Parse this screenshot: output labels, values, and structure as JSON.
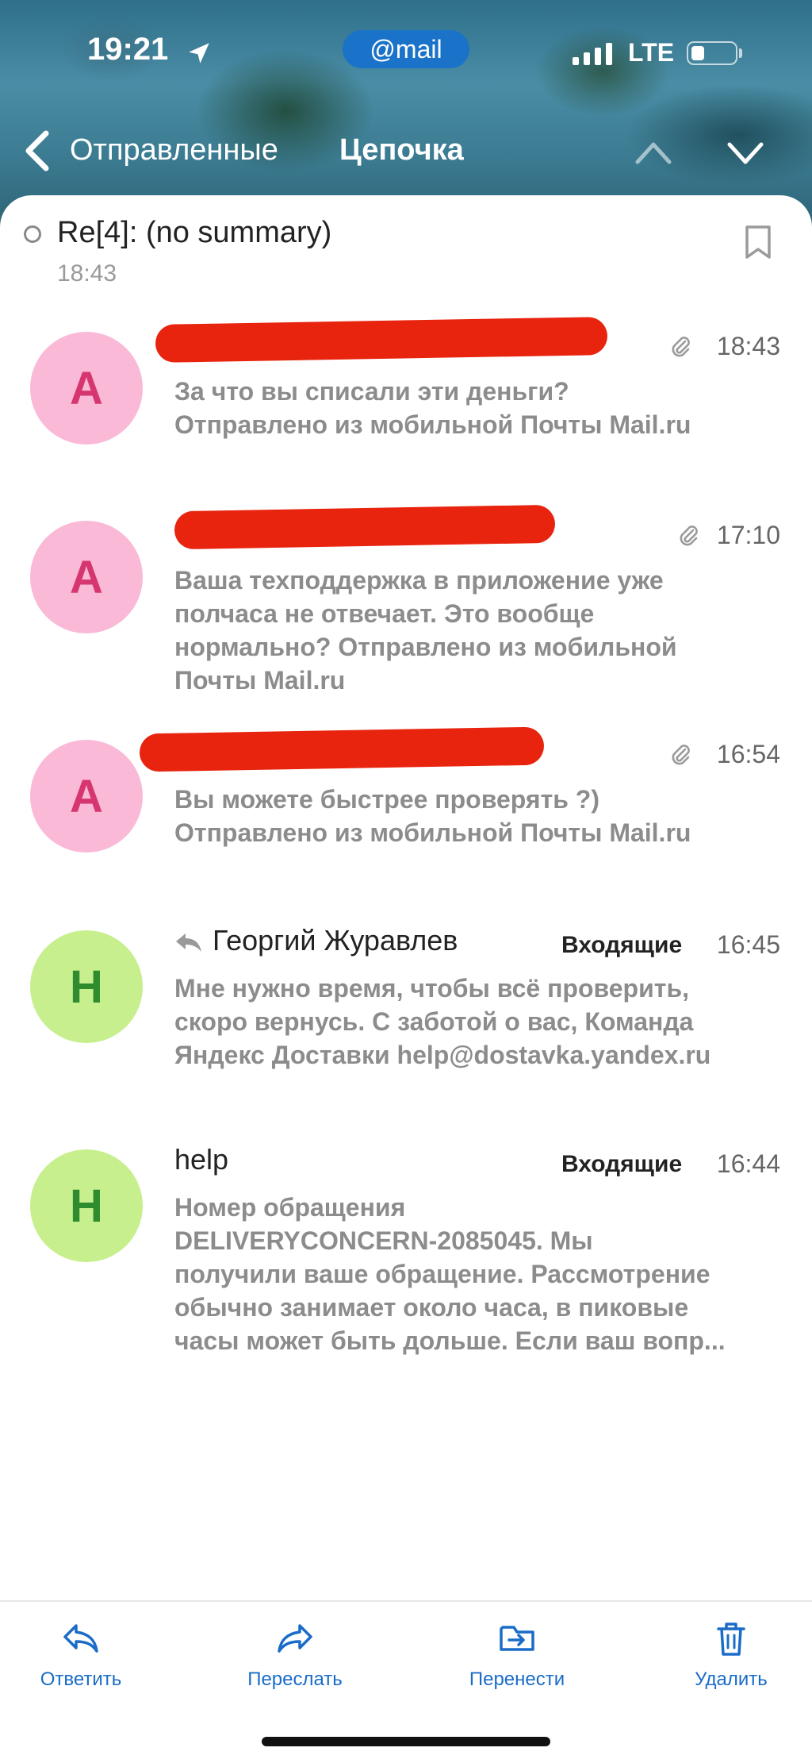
{
  "status_bar": {
    "time": "19:21",
    "mail_badge": "@mail",
    "network": "LTE"
  },
  "nav": {
    "back_label": "Отправленные",
    "title": "Цепочка"
  },
  "thread": {
    "subject": "Re[4]: (no summary)",
    "time": "18:43"
  },
  "messages": [
    {
      "avatar_letter": "A",
      "sender": "",
      "time": "18:43",
      "has_attachment": true,
      "preview_lines": [
        "За что вы списали эти деньги?",
        "Отправлено из мобильной Почты Mail.ru"
      ]
    },
    {
      "avatar_letter": "A",
      "sender": "",
      "time": "17:10",
      "has_attachment": true,
      "preview_lines": [
        "Ваша техподдержка в приложение уже",
        "полчаса не отвечает. Это вообще",
        "нормально? Отправлено из мобильной",
        "Почты Mail.ru"
      ]
    },
    {
      "avatar_letter": "A",
      "sender": "",
      "time": "16:54",
      "has_attachment": true,
      "preview_lines": [
        "Вы можете быстрее проверять ?)",
        "Отправлено из мобильной Почты Mail.ru"
      ]
    },
    {
      "avatar_letter": "H",
      "sender": "Георгий Журавлев",
      "folder": "Входящие",
      "time": "16:45",
      "preview_lines": [
        "Мне нужно время, чтобы всё проверить,",
        "скоро вернусь. С заботой о вас, Команда",
        "Яндекс Доставки help@dostavka.yandex.ru"
      ]
    },
    {
      "avatar_letter": "H",
      "sender": "help",
      "folder": "Входящие",
      "time": "16:44",
      "preview_lines": [
        "Номер обращения",
        "DELIVERYCONCERN-2085045. Мы",
        "получили ваше обращение. Рассмотрение",
        "обычно занимает около часа, в пиковые",
        "часы может быть дольше. Если ваш вопр..."
      ]
    }
  ],
  "toolbar": {
    "reply": "Ответить",
    "forward": "Переслать",
    "move": "Перенести",
    "delete": "Удалить"
  },
  "colors": {
    "accent": "#1a6cc8",
    "avatar_pink": "#f9b9d7",
    "avatar_green": "#c7ef8e",
    "redaction": "#e8240f"
  }
}
